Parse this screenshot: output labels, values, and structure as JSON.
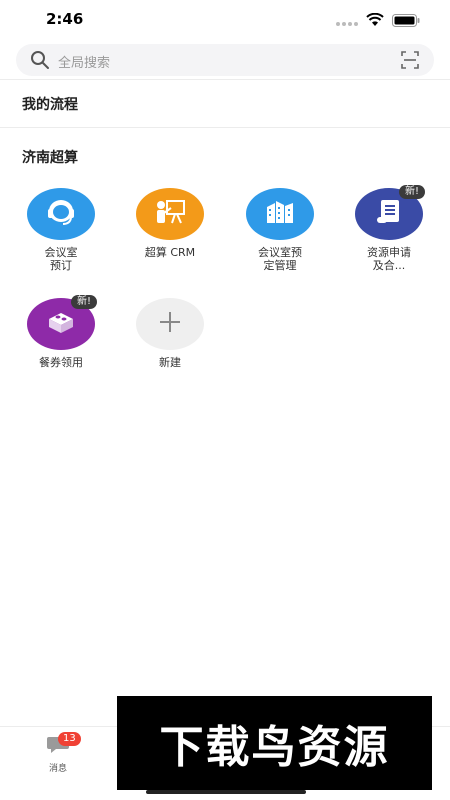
{
  "status_bar": {
    "time": "2:46"
  },
  "search": {
    "placeholder": "全局搜索"
  },
  "sections": {
    "my_workflow": "我的流程",
    "group_title": "济南超算"
  },
  "apps": [
    {
      "label_line1": "会议室",
      "label_line2": "预订",
      "icon": "headset-icon",
      "color": "#2f9ae8",
      "badge": ""
    },
    {
      "label_line1": "超算 CRM",
      "label_line2": "",
      "icon": "presentation-icon",
      "color": "#f39a19",
      "badge": ""
    },
    {
      "label_line1": "会议室预",
      "label_line2": "定管理",
      "icon": "building-icon",
      "color": "#2f9ae8",
      "badge": ""
    },
    {
      "label_line1": "资源申请",
      "label_line2": "及合...",
      "icon": "document-icon",
      "color": "#3a4ba6",
      "badge": "新!"
    },
    {
      "label_line1": "餐券领用",
      "label_line2": "",
      "icon": "blocks-icon",
      "color": "#8e2aa8",
      "badge": "新!"
    },
    {
      "label_line1": "新建",
      "label_line2": "",
      "icon": "plus-icon",
      "color": "#efefef",
      "badge": ""
    }
  ],
  "tab_bar": {
    "messages_label": "消息",
    "messages_count": "13"
  },
  "watermark": {
    "text": "下载鸟资源"
  }
}
